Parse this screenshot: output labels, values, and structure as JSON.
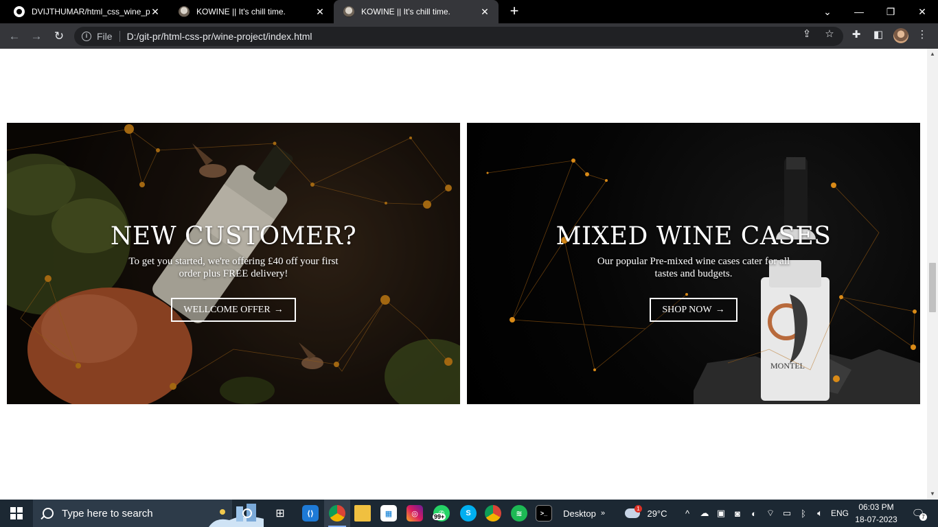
{
  "browser": {
    "tabs": [
      {
        "title": "DVIJTHUMAR/html_css_wine_pro",
        "active": false
      },
      {
        "title": "KOWINE || It's chill time.",
        "active": false
      },
      {
        "title": "KOWINE || It's chill time.",
        "active": true
      }
    ],
    "new_tab_icon": "plus-icon",
    "address": {
      "scheme": "File",
      "url": "D:/git-pr/html-css-pr/wine-project/index.html"
    }
  },
  "page": {
    "cards": [
      {
        "heading": "NEW CUSTOMER?",
        "text": "To get you started, we're offering £40 off your first order plus FREE delivery!",
        "button": "WELLCOME OFFER",
        "button_arrow": "→"
      },
      {
        "heading": "MIXED WINE CASES",
        "text": "Our popular Pre-mixed wine cases cater for all tastes and budgets.",
        "button": "SHOP NOW",
        "button_arrow": "→"
      }
    ],
    "bottle_label": "MONTEL"
  },
  "taskbar": {
    "search_placeholder": "Type here to search",
    "whatsapp_badge": "99+",
    "desktop_label": "Desktop",
    "weather": {
      "temp": "29°C",
      "badge": "1"
    },
    "language": "ENG",
    "time": "06:03 PM",
    "date": "18-07-2023",
    "notifications": "7"
  },
  "colors": {
    "accent_node": "#e08b14",
    "toolbar": "#35363a",
    "tabstrip": "#000000",
    "taskbar": "#1c2833"
  }
}
